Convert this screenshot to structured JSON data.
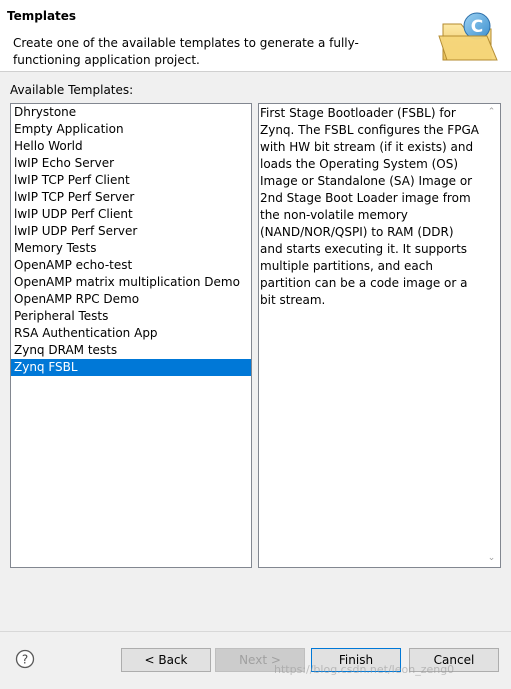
{
  "header": {
    "title": "Templates",
    "description": "Create one of the available templates to generate a fully-functioning application project."
  },
  "templates": {
    "label": "Available Templates:",
    "items": [
      "Dhrystone",
      "Empty Application",
      "Hello World",
      "lwIP Echo Server",
      "lwIP TCP Perf Client",
      "lwIP TCP Perf Server",
      "lwIP UDP Perf Client",
      "lwIP UDP Perf Server",
      "Memory Tests",
      "OpenAMP echo-test",
      "OpenAMP matrix multiplication Demo",
      "OpenAMP RPC Demo",
      "Peripheral Tests",
      "RSA Authentication App",
      "Zynq DRAM tests",
      "Zynq FSBL"
    ],
    "selected": "Zynq FSBL"
  },
  "description_panel": {
    "text": "First Stage Bootloader (FSBL) for\nZynq. The FSBL configures the FPGA\nwith HW bit stream (if it exists)  and\nloads the Operating System (OS)\nImage or Standalone (SA) Image or\n2nd Stage Boot Loader image from\nthe  non-volatile memory\n(NAND/NOR/QSPI) to RAM (DDR)\nand starts executing it.  It supports\nmultiple partitions,  and each\npartition can be a code image or a\nbit stream."
  },
  "buttons": {
    "back": "< Back",
    "next": "Next >",
    "finish": "Finish",
    "cancel": "Cancel"
  },
  "icons": {
    "help": "help-icon",
    "banner": "folder-c-icon"
  },
  "colors": {
    "selection": "#0078d7",
    "background": "#f0f0f0"
  },
  "watermark": "https://blog.csdn.net/leon_zeng0"
}
